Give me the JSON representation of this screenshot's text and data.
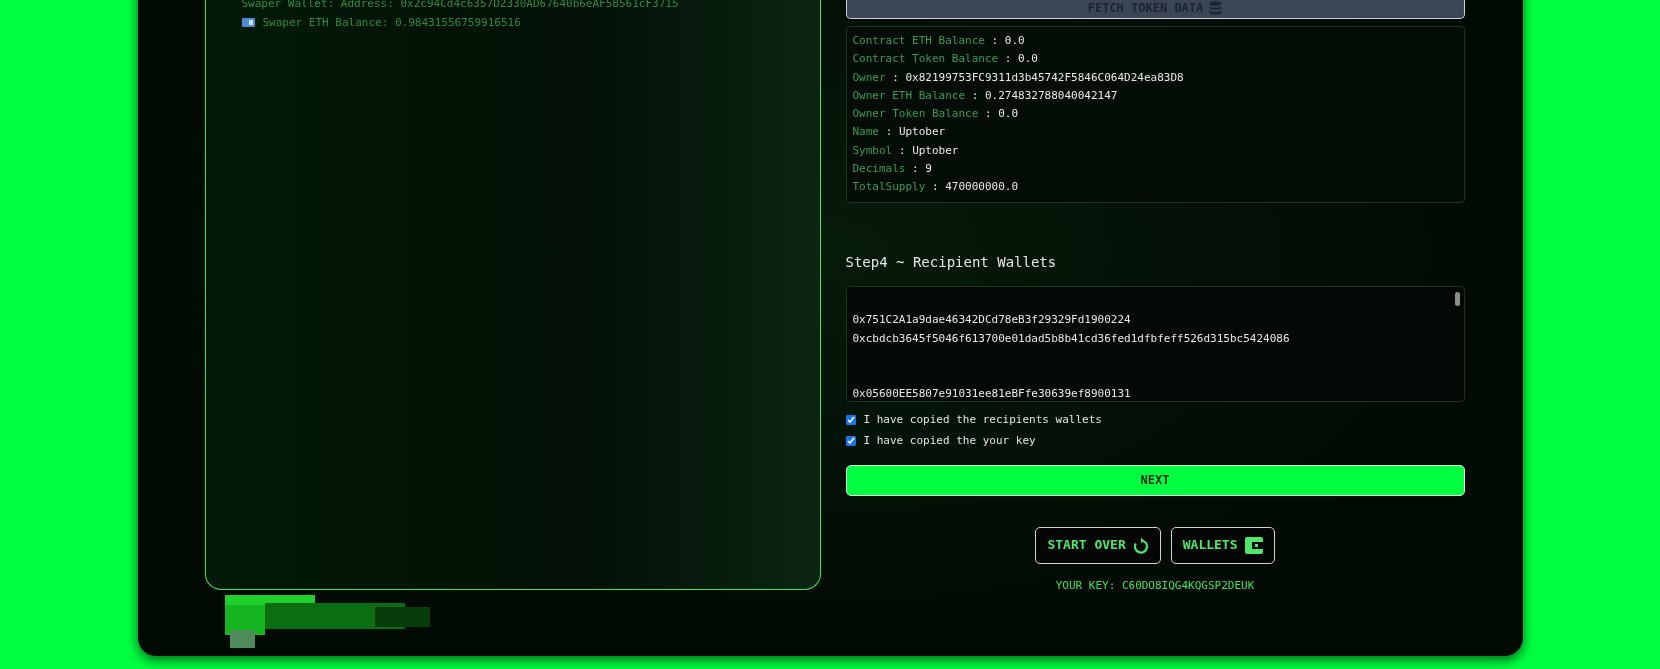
{
  "swaper_wallet": {
    "address_line": "Swaper Wallet: Address: 0x2c94Cd4c6357D2330AD67640b6eAF58561cF3715",
    "balance_line": "Swaper ETH Balance: 0.98431556759916516"
  },
  "fetch_button": {
    "label": "FETCH TOKEN DATA"
  },
  "token_info": [
    {
      "label": "Contract ETH Balance",
      "separator": ":",
      "value": "0.0"
    },
    {
      "label": "Contract Token Balance",
      "separator": ":",
      "value": "0.0"
    },
    {
      "label": "Owner",
      "separator": ":",
      "value": "0x82199753FC9311d3b45742F5846C064D24ea83D8"
    },
    {
      "label": "Owner ETH Balance",
      "separator": ":",
      "value": "0.274832788040042147"
    },
    {
      "label": "Owner Token Balance",
      "separator": ":",
      "value": "0.0"
    },
    {
      "label": "Name",
      "separator": ":",
      "value": "Uptober"
    },
    {
      "label": "Symbol",
      "separator": ":",
      "value": "Uptober"
    },
    {
      "label": "Decimals",
      "separator": ":",
      "value": "9"
    },
    {
      "label": "TotalSupply",
      "separator": ":",
      "value": "470000000.0"
    }
  ],
  "step4": {
    "title": "Step4 ~ Recipient Wallets",
    "lines": [
      {
        "kind": "blank"
      },
      {
        "kind": "address",
        "text": "0x751C2A1a9dae46342DCd78eB3f29329Fd1900224"
      },
      {
        "kind": "address",
        "text": "0xcbdcb3645f5046f613700e01dad5b8b41cd36fed1dfbfeff526d315bc5424086"
      },
      {
        "kind": "blank"
      },
      {
        "kind": "blank"
      },
      {
        "kind": "address",
        "text": "0x05600EE5807e91031ee81eBFfe30639ef8900131"
      }
    ],
    "checkboxes": [
      {
        "label": "I have copied the recipients wallets",
        "checked": true
      },
      {
        "label": "I have copied the your key",
        "checked": true
      }
    ]
  },
  "next_button": {
    "label": "NEXT"
  },
  "actions": [
    {
      "kind": "restart",
      "label": "START OVER"
    },
    {
      "kind": "wallet",
      "label": "WALLETS"
    }
  ],
  "your_key": "YOUR KEY: C60DO8IQG4KQGSP2DEUK"
}
